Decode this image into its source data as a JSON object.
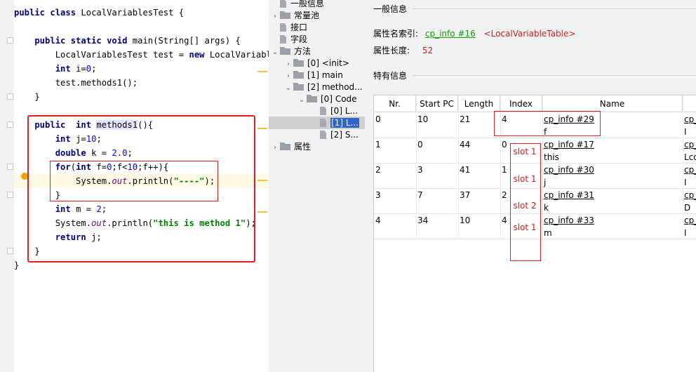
{
  "editor": {
    "lines": [
      [
        [
          "kw",
          "public class "
        ],
        [
          "",
          "LocalVariablesTest {"
        ]
      ],
      [],
      [
        [
          "kw",
          "    public static void "
        ],
        [
          "",
          "main(String[] args) {"
        ]
      ],
      [
        [
          "",
          "        LocalVariablesTest test = "
        ],
        [
          "kw",
          "new "
        ],
        [
          "",
          "LocalVariablesTest();"
        ]
      ],
      [
        [
          "kw",
          "        int "
        ],
        [
          "",
          "i="
        ],
        [
          "num",
          "0"
        ],
        [
          "",
          ";"
        ]
      ],
      [
        [
          "",
          "        test.methods1();"
        ]
      ],
      [
        [
          "",
          "    }"
        ]
      ],
      [],
      [
        [
          "kw",
          "    public  int "
        ],
        [
          "fn",
          "methods1"
        ],
        [
          "",
          "(){"
        ]
      ],
      [
        [
          "kw",
          "        int "
        ],
        [
          "",
          "j="
        ],
        [
          "num",
          "10"
        ],
        [
          "",
          ";"
        ]
      ],
      [
        [
          "kw",
          "        double "
        ],
        [
          "",
          "k = "
        ],
        [
          "num",
          "2.0"
        ],
        [
          "",
          ";"
        ]
      ],
      [
        [
          "kw",
          "        for"
        ],
        [
          "",
          "("
        ],
        [
          "kw",
          "int "
        ],
        [
          "",
          "f="
        ],
        [
          "num",
          "0"
        ],
        [
          "",
          ";f<"
        ],
        [
          "num",
          "10"
        ],
        [
          "",
          ";f++){"
        ]
      ],
      [
        [
          "",
          "            System."
        ],
        [
          "st",
          "out"
        ],
        [
          "",
          ".println("
        ],
        [
          "str",
          "\"----\""
        ],
        [
          "",
          ");"
        ]
      ],
      [
        [
          "",
          "        }"
        ]
      ],
      [
        [
          "kw",
          "        int "
        ],
        [
          "",
          "m = "
        ],
        [
          "num",
          "2"
        ],
        [
          "",
          ";"
        ]
      ],
      [
        [
          "",
          "        System."
        ],
        [
          "st",
          "out"
        ],
        [
          "",
          ".println("
        ],
        [
          "str",
          "\"this is method 1\""
        ],
        [
          "",
          ");"
        ]
      ],
      [
        [
          "kw",
          "        return "
        ],
        [
          "",
          "j;"
        ]
      ],
      [
        [
          "",
          "    }"
        ]
      ],
      [
        [
          "",
          "}"
        ]
      ]
    ]
  },
  "tree": {
    "nodes": [
      {
        "label": "一般信息",
        "type": "file",
        "level": 0,
        "arrow": ""
      },
      {
        "label": "常量池",
        "type": "folder",
        "level": 0,
        "arrow": "›"
      },
      {
        "label": "接口",
        "type": "file",
        "level": 0,
        "arrow": ""
      },
      {
        "label": "字段",
        "type": "file",
        "level": 0,
        "arrow": ""
      },
      {
        "label": "方法",
        "type": "folder",
        "level": 0,
        "arrow": "⌄"
      },
      {
        "label": "[0] <init>",
        "type": "folder",
        "level": 1,
        "arrow": "›"
      },
      {
        "label": "[1] main",
        "type": "folder",
        "level": 1,
        "arrow": "›"
      },
      {
        "label": "[2] method...",
        "type": "folder",
        "level": 1,
        "arrow": "⌄"
      },
      {
        "label": "[0] Code",
        "type": "folder",
        "level": 2,
        "arrow": "⌄"
      },
      {
        "label": "[0] L...",
        "type": "file",
        "level": 3,
        "arrow": ""
      },
      {
        "label": "[1] L...",
        "type": "file",
        "level": 3,
        "arrow": "",
        "selected": true
      },
      {
        "label": "[2] S...",
        "type": "file",
        "level": 3,
        "arrow": ""
      },
      {
        "label": "属性",
        "type": "folder",
        "level": 0,
        "arrow": "›"
      }
    ]
  },
  "detail": {
    "general_title": "一般信息",
    "name_index_label": "属性名索引:",
    "name_index_link": "cp_info #16",
    "name_index_value": "<LocalVariableTable>",
    "length_label": "属性长度:",
    "length_value": "52",
    "specific_title": "特有信息",
    "columns": [
      "Nr.",
      "Start PC",
      "Length",
      "Index",
      "Name",
      ""
    ],
    "rows": [
      {
        "nr": "0",
        "start": "10",
        "length": "21",
        "index": "4",
        "name_link": "cp_info #29",
        "name": "f",
        "desc_link": "cp_",
        "desc": "I"
      },
      {
        "nr": "1",
        "start": "0",
        "length": "44",
        "index": "0",
        "name_link": "cp_info #17",
        "name": "this",
        "desc_link": "cp_",
        "desc": "Lco"
      },
      {
        "nr": "2",
        "start": "3",
        "length": "41",
        "index": "1",
        "name_link": "cp_info #30",
        "name": "j",
        "desc_link": "cp_",
        "desc": "I"
      },
      {
        "nr": "3",
        "start": "7",
        "length": "37",
        "index": "2",
        "name_link": "cp_info #31",
        "name": "k",
        "desc_link": "cp_",
        "desc": "D"
      },
      {
        "nr": "4",
        "start": "34",
        "length": "10",
        "index": "4",
        "name_link": "cp_info #33",
        "name": "m",
        "desc_link": "cp_",
        "desc": "I"
      }
    ],
    "slots": [
      "slot 1",
      "slot 1",
      "slot 2",
      "slot 1"
    ]
  },
  "colors": {
    "accent_red": "#e02020",
    "link_green": "#0f9d0f",
    "selection": "#2f65ca"
  }
}
